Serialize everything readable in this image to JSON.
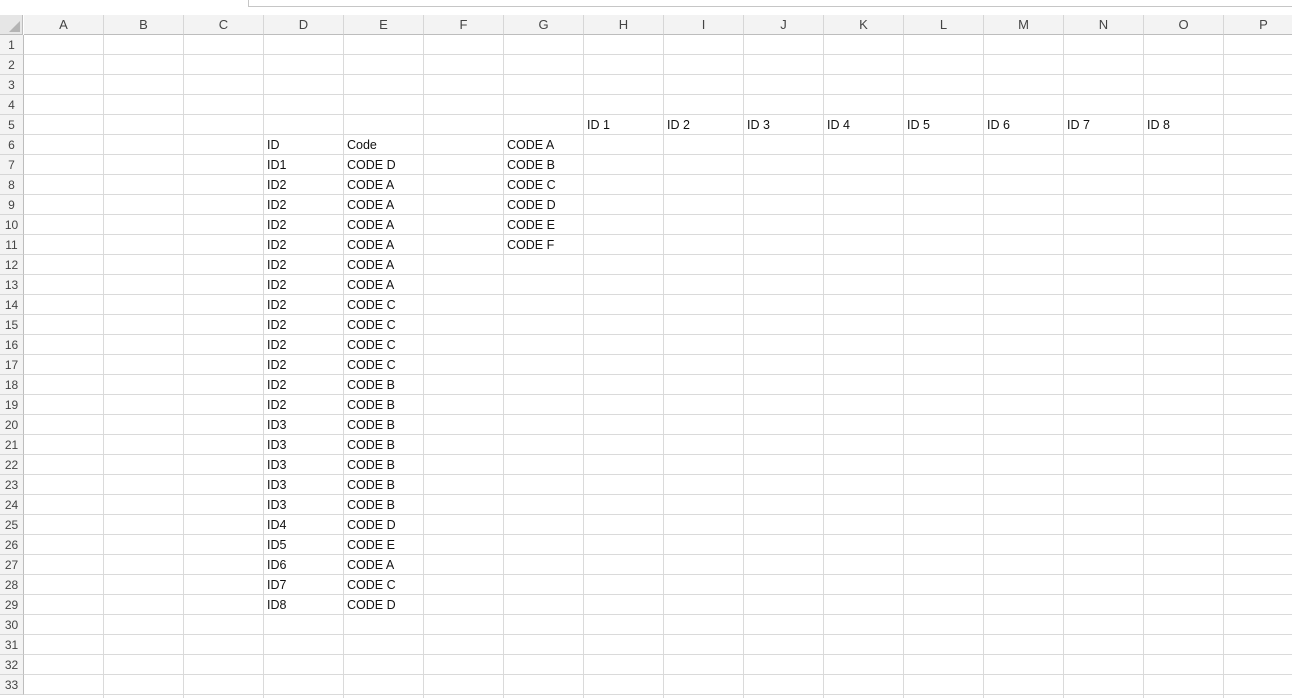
{
  "columns": [
    "A",
    "B",
    "C",
    "D",
    "E",
    "F",
    "G",
    "H",
    "I",
    "J",
    "K",
    "L",
    "M",
    "N",
    "O",
    "P"
  ],
  "rows": [
    "1",
    "2",
    "3",
    "4",
    "5",
    "6",
    "7",
    "8",
    "9",
    "10",
    "11",
    "12",
    "13",
    "14",
    "15",
    "16",
    "17",
    "18",
    "19",
    "20",
    "21",
    "22",
    "23",
    "24",
    "25",
    "26",
    "27",
    "28",
    "29",
    "30",
    "31",
    "32",
    "33"
  ],
  "data_table": {
    "header": {
      "id": "ID",
      "code": "Code"
    },
    "rows": [
      {
        "id": "ID1",
        "code": "CODE D"
      },
      {
        "id": "ID2",
        "code": "CODE A"
      },
      {
        "id": "ID2",
        "code": "CODE A"
      },
      {
        "id": "ID2",
        "code": "CODE A"
      },
      {
        "id": "ID2",
        "code": "CODE A"
      },
      {
        "id": "ID2",
        "code": "CODE A"
      },
      {
        "id": "ID2",
        "code": "CODE A"
      },
      {
        "id": "ID2",
        "code": "CODE C"
      },
      {
        "id": "ID2",
        "code": "CODE C"
      },
      {
        "id": "ID2",
        "code": "CODE C"
      },
      {
        "id": "ID2",
        "code": "CODE C"
      },
      {
        "id": "ID2",
        "code": "CODE B"
      },
      {
        "id": "ID2",
        "code": "CODE B"
      },
      {
        "id": "ID3",
        "code": "CODE B"
      },
      {
        "id": "ID3",
        "code": "CODE B"
      },
      {
        "id": "ID3",
        "code": "CODE B"
      },
      {
        "id": "ID3",
        "code": "CODE B"
      },
      {
        "id": "ID3",
        "code": "CODE B"
      },
      {
        "id": "ID4",
        "code": "CODE D"
      },
      {
        "id": "ID5",
        "code": "CODE E"
      },
      {
        "id": "ID6",
        "code": "CODE A"
      },
      {
        "id": "ID7",
        "code": "CODE C"
      },
      {
        "id": "ID8",
        "code": "CODE D"
      }
    ]
  },
  "matrix": {
    "row_labels": [
      "CODE A",
      "CODE B",
      "CODE C",
      "CODE D",
      "CODE E",
      "CODE F"
    ],
    "col_labels": [
      "ID 1",
      "ID 2",
      "ID 3",
      "ID 4",
      "ID 5",
      "ID 6",
      "ID 7",
      "ID 8"
    ]
  }
}
